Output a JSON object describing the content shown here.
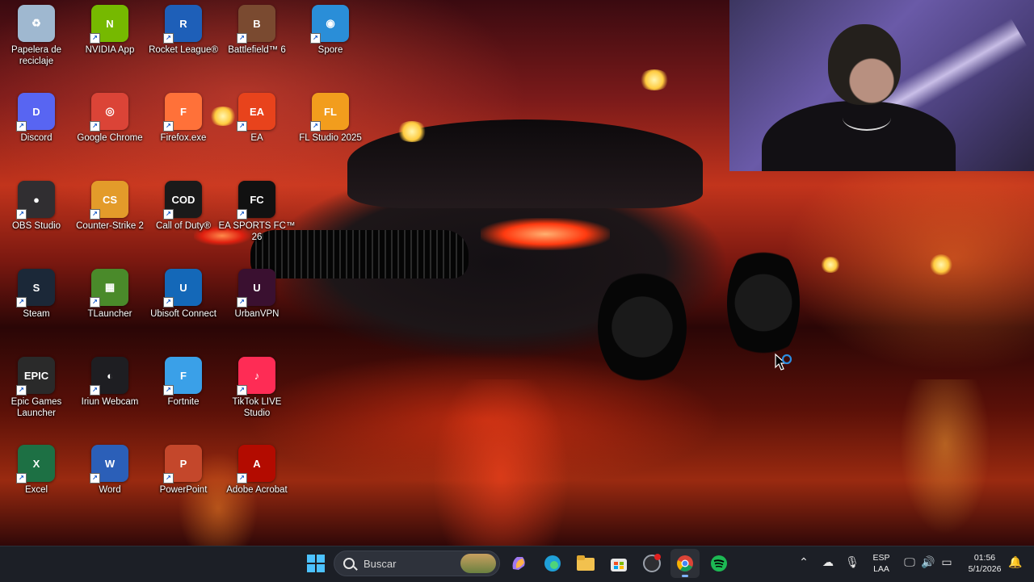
{
  "desktop": {
    "icons": [
      {
        "label": "Papelera de reciclaje",
        "icon": "recycle-bin-icon",
        "color": "#9fb8d0",
        "glyph": "♻"
      },
      {
        "label": "NVIDIA App",
        "icon": "nvidia-icon",
        "color": "#76b900",
        "glyph": "N"
      },
      {
        "label": "Rocket League®",
        "icon": "rocket-league-icon",
        "color": "#1e5fb8",
        "glyph": "R"
      },
      {
        "label": "Battlefield™ 6",
        "icon": "battlefield-icon",
        "color": "#7a4a30",
        "glyph": "B"
      },
      {
        "label": "Spore",
        "icon": "spore-icon",
        "color": "#2a8ed8",
        "glyph": "◉"
      },
      {
        "label": "Discord",
        "icon": "discord-icon",
        "color": "#5865f2",
        "glyph": "D"
      },
      {
        "label": "Google Chrome",
        "icon": "chrome-icon",
        "color": "#db4437",
        "glyph": "◎"
      },
      {
        "label": "Firefox.exe",
        "icon": "firefox-icon",
        "color": "#ff7139",
        "glyph": "F"
      },
      {
        "label": "EA",
        "icon": "ea-icon",
        "color": "#e8431c",
        "glyph": "EA"
      },
      {
        "label": "FL Studio 2025",
        "icon": "fl-studio-icon",
        "color": "#f29d1d",
        "glyph": "FL"
      },
      {
        "label": "OBS Studio",
        "icon": "obs-icon",
        "color": "#302e31",
        "glyph": "●"
      },
      {
        "label": "Counter-Strike 2",
        "icon": "counter-strike-icon",
        "color": "#e39b2a",
        "glyph": "CS"
      },
      {
        "label": "Call of Duty®",
        "icon": "call-of-duty-icon",
        "color": "#1a1a1a",
        "glyph": "COD"
      },
      {
        "label": "EA SPORTS FC™ 26",
        "icon": "ea-sports-fc-icon",
        "color": "#111111",
        "glyph": "FC"
      },
      {
        "label": "Steam",
        "icon": "steam-icon",
        "color": "#1b2838",
        "glyph": "S"
      },
      {
        "label": "TLauncher",
        "icon": "tlauncher-icon",
        "color": "#4a8a2a",
        "glyph": "▦"
      },
      {
        "label": "Ubisoft Connect",
        "icon": "ubisoft-icon",
        "color": "#1468b8",
        "glyph": "U"
      },
      {
        "label": "UrbanVPN",
        "icon": "urbanvpn-icon",
        "color": "#3a1030",
        "glyph": "U"
      },
      {
        "label": "Epic Games Launcher",
        "icon": "epic-games-icon",
        "color": "#2a2a2a",
        "glyph": "EPIC"
      },
      {
        "label": "Iriun Webcam",
        "icon": "iriun-webcam-icon",
        "color": "#1e1e22",
        "glyph": "◐"
      },
      {
        "label": "Fortnite",
        "icon": "fortnite-icon",
        "color": "#3aa0e8",
        "glyph": "F"
      },
      {
        "label": "TikTok LIVE Studio",
        "icon": "tiktok-live-icon",
        "color": "#fe2c55",
        "glyph": "♪"
      },
      {
        "label": "Excel",
        "icon": "excel-icon",
        "color": "#1d7044",
        "glyph": "X"
      },
      {
        "label": "Word",
        "icon": "word-icon",
        "color": "#2b5fb8",
        "glyph": "W"
      },
      {
        "label": "PowerPoint",
        "icon": "powerpoint-icon",
        "color": "#c4472b",
        "glyph": "P"
      },
      {
        "label": "Adobe Acrobat",
        "icon": "adobe-acrobat-icon",
        "color": "#b30b00",
        "glyph": "A"
      }
    ]
  },
  "taskbar": {
    "search_placeholder": "Buscar",
    "apps": [
      {
        "name": "start",
        "icon": "windows-start-icon",
        "color": "#4cc2ff"
      },
      {
        "name": "copilot",
        "icon": "copilot-icon",
        "color": "#a078f0"
      },
      {
        "name": "edge",
        "icon": "edge-icon",
        "color": "#1fa0d8"
      },
      {
        "name": "file-explorer",
        "icon": "file-explorer-icon",
        "color": "#f2c14e"
      },
      {
        "name": "microsoft-store",
        "icon": "microsoft-store-icon",
        "color": "#e8e8e8"
      },
      {
        "name": "obs",
        "icon": "obs-taskbar-icon",
        "color": "#9aa0aa"
      },
      {
        "name": "chrome",
        "icon": "chrome-taskbar-icon",
        "color": "#db4437"
      },
      {
        "name": "spotify",
        "icon": "spotify-icon",
        "color": "#1db954"
      }
    ],
    "tray": {
      "language_top": "ESP",
      "language_bottom": "LAA",
      "time": "01:56",
      "date": "5/1/2026"
    }
  }
}
